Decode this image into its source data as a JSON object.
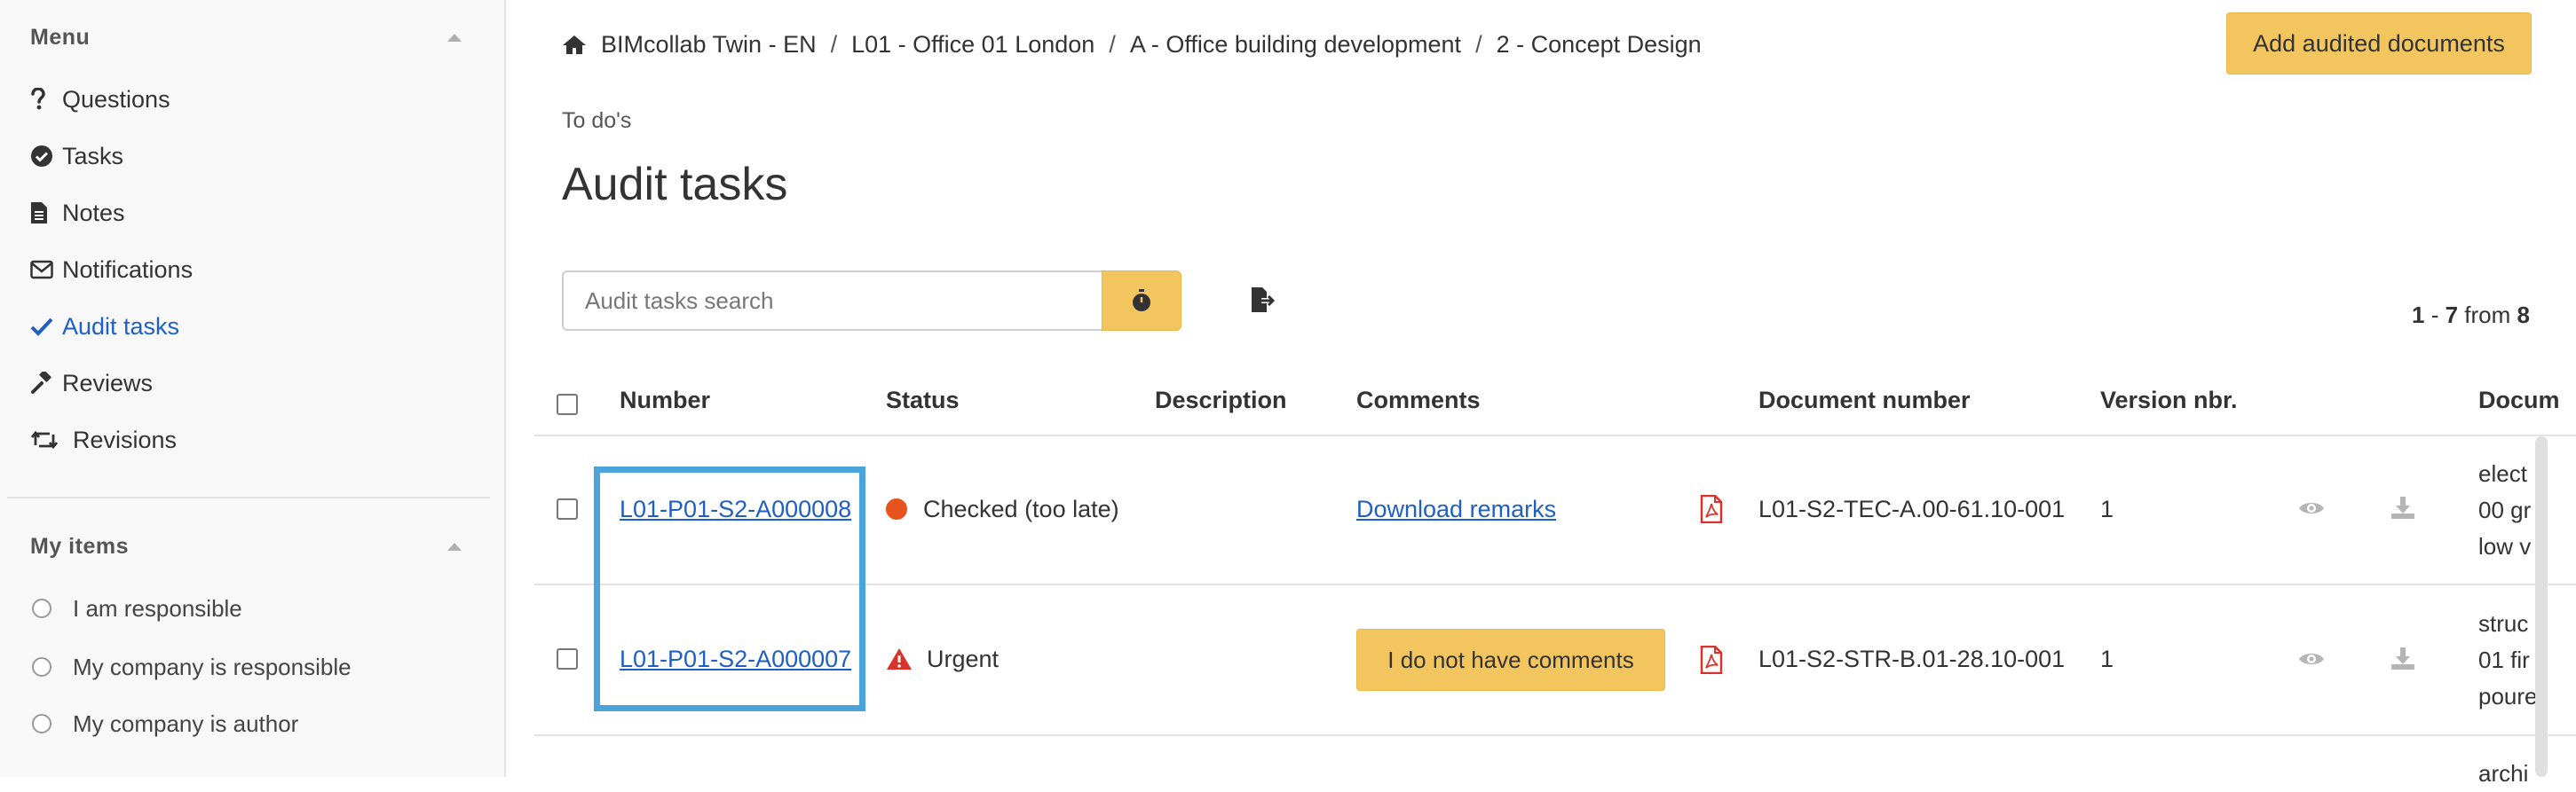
{
  "sidebar": {
    "menu_title": "Menu",
    "items": [
      {
        "label": "Questions",
        "icon": "question-icon"
      },
      {
        "label": "Tasks",
        "icon": "check-circle-icon"
      },
      {
        "label": "Notes",
        "icon": "file-icon"
      },
      {
        "label": "Notifications",
        "icon": "envelope-icon"
      },
      {
        "label": "Audit tasks",
        "icon": "check-icon",
        "active": true
      },
      {
        "label": "Reviews",
        "icon": "gavel-icon"
      },
      {
        "label": "Revisions",
        "icon": "retweet-icon"
      }
    ],
    "my_items_title": "My items",
    "filters": [
      {
        "label": "I am responsible"
      },
      {
        "label": "My company is responsible"
      },
      {
        "label": "My company is author"
      }
    ]
  },
  "breadcrumb": {
    "items": [
      "BIMcollab Twin - EN",
      "L01 - Office 01 London",
      "A - Office building development",
      "2 - Concept Design"
    ],
    "separator": "/"
  },
  "actions": {
    "add_audited_documents": "Add audited documents"
  },
  "header": {
    "section": "To do's",
    "title": "Audit tasks"
  },
  "search": {
    "placeholder": "Audit tasks search"
  },
  "pager": {
    "start": "1",
    "dash": "-",
    "end": "7",
    "from_label": "from",
    "total": "8"
  },
  "table": {
    "columns": {
      "number": "Number",
      "status": "Status",
      "description": "Description",
      "comments": "Comments",
      "document_number": "Document number",
      "version": "Version nbr.",
      "document": "Docum"
    },
    "rows": [
      {
        "number": "L01-P01-S2-A000008",
        "status": "Checked (too late)",
        "comments": "Download remarks",
        "document_number": "L01-S2-TEC-A.00-61.10-001",
        "version": "1",
        "doc_lines": [
          "elect",
          "00 gr",
          "low v"
        ]
      },
      {
        "number": "L01-P01-S2-A000007",
        "status": "Urgent",
        "comments": "I do not have comments",
        "document_number": "L01-S2-STR-B.01-28.10-001",
        "version": "1",
        "doc_lines": [
          "struc",
          "01 fir",
          "poure"
        ]
      },
      {
        "doc_lines": [
          "archi"
        ]
      }
    ]
  },
  "colors": {
    "accent_yellow": "#f3c55f",
    "link_blue": "#1f5fc5",
    "status_orange": "#e8521c",
    "urgent_red": "#d9322a",
    "highlight_blue": "#4aa3db"
  }
}
